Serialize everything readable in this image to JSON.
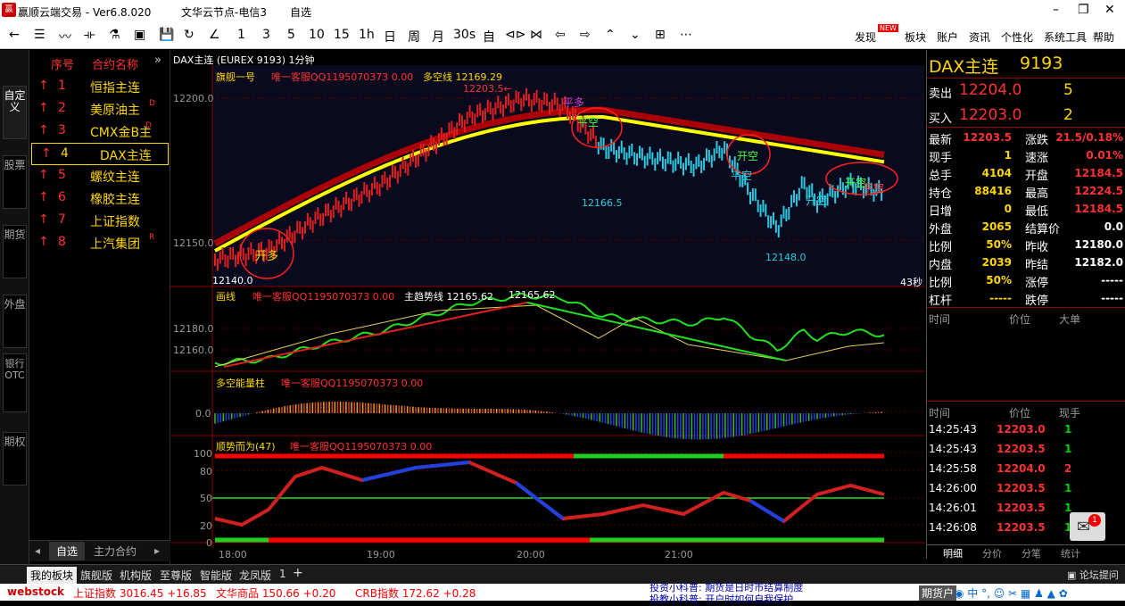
{
  "window": {
    "title": "赢顺云端交易 - Ver6.8.020",
    "node": "文华云节点-电信3",
    "mode": "自选",
    "win_buttons": [
      "–",
      "❐",
      "✕"
    ]
  },
  "toolbar": {
    "icons": [
      "←",
      "☰",
      "〰",
      "⟛",
      "⚗",
      "▣",
      "💾",
      "↻",
      "∠",
      "1",
      "3",
      "5",
      "10",
      "15",
      "1h",
      "日",
      "周",
      "月",
      "30s",
      "自",
      "⊲⊳",
      "⋈",
      "⇦",
      "⇨",
      "⌃",
      "⌄",
      "⊞",
      "⋯"
    ],
    "menu": [
      "发现",
      "板块",
      "账户",
      "资讯",
      "个性化",
      "系统工具",
      "帮助"
    ],
    "new_badge": "NEW"
  },
  "left_tabs": [
    "自定义",
    "股票",
    "期货",
    "外盘",
    "银行OTC",
    "期权"
  ],
  "watchlist": {
    "headers": [
      "序号",
      "合约名称"
    ],
    "more": "»",
    "rows": [
      {
        "n": "1",
        "name": "恒指主连",
        "sup": ""
      },
      {
        "n": "2",
        "name": "美原油主",
        "sup": "D"
      },
      {
        "n": "3",
        "name": "CMX金B主",
        "sup": "D"
      },
      {
        "n": "4",
        "name": "DAX主连",
        "sup": ""
      },
      {
        "n": "5",
        "name": "螺纹主连",
        "sup": ""
      },
      {
        "n": "6",
        "name": "橡胶主连",
        "sup": ""
      },
      {
        "n": "7",
        "name": "上证指数",
        "sup": ""
      },
      {
        "n": "8",
        "name": "上汽集团",
        "sup": "R"
      }
    ],
    "footer": [
      "自选",
      "主力合约"
    ]
  },
  "chart": {
    "header": "DAX主连 (EUREX 9193)  1分钟",
    "p1": {
      "name": "旗舰一号",
      "qq": "唯一客服QQ1195070373 0.00",
      "line_label": "多空线 12169.29",
      "y_ticks": [
        "12200.0",
        "12150.0"
      ],
      "annotations": [
        "12203.5←",
        "12166.5",
        "12148.0",
        "平多",
        "平空",
        "开空",
        "平空",
        "开空",
        "开空",
        "开多",
        "平空"
      ],
      "low": "12140.0",
      "countdown": "43秒"
    },
    "p2": {
      "name": "画线",
      "qq": "唯一客服QQ1195070373 0.00",
      "trend": "主趋势线 12165.62",
      "value": "12165.62",
      "y_ticks": [
        "12180.0",
        "12160.0"
      ]
    },
    "p3": {
      "name": "多空能量柱",
      "qq": "唯一客服QQ1195070373 0.00",
      "y_ticks": [
        "0.0"
      ]
    },
    "p4": {
      "name": "顺势而为(47)",
      "qq": "唯一客服QQ1195070373 0.00",
      "y_ticks": [
        "100",
        "80",
        "50",
        "20",
        "0"
      ]
    },
    "x_ticks": [
      "18:00",
      "19:00",
      "20:00",
      "21:00"
    ]
  },
  "quote": {
    "title": "DAX主连",
    "code": "9193",
    "sell": {
      "label": "卖出",
      "price": "12204.0",
      "vol": "5"
    },
    "buy": {
      "label": "买入",
      "price": "12203.0",
      "vol": "2"
    },
    "rows": [
      [
        "最新",
        "12203.5",
        "涨跌",
        "21.5/0.18%"
      ],
      [
        "现手",
        "1",
        "速涨",
        "0.01%"
      ],
      [
        "总手",
        "4104",
        "开盘",
        "12184.5"
      ],
      [
        "持仓",
        "88416",
        "最高",
        "12224.5"
      ],
      [
        "日增",
        "0",
        "最低",
        "12184.5"
      ],
      [
        "外盘",
        "2065",
        "结算价",
        "0.0"
      ],
      [
        "比例",
        "50%",
        "昨收",
        "12180.0"
      ],
      [
        "内盘",
        "2039",
        "昨结",
        "12182.0"
      ],
      [
        "比例",
        "50%",
        "涨停",
        "-----"
      ],
      [
        "杠杆",
        "-----",
        "跌停",
        "-----"
      ]
    ],
    "big_headers": [
      "时间",
      "价位",
      "大单"
    ],
    "tick_headers": [
      "时间",
      "价位",
      "现手"
    ],
    "ticks": [
      [
        "14:25:43",
        "12203.0",
        "1"
      ],
      [
        "14:25:43",
        "12203.5",
        "1"
      ],
      [
        "14:25:58",
        "12204.0",
        "2"
      ],
      [
        "14:26:00",
        "12203.5",
        "1"
      ],
      [
        "14:26:01",
        "12203.5",
        "1"
      ],
      [
        "14:26:08",
        "12203.5",
        "1"
      ]
    ],
    "tabs": [
      "明细",
      "分价",
      "分笔",
      "统计"
    ],
    "mail_badge": "1"
  },
  "bottom_tabs": [
    "我的板块",
    "旗舰版",
    "机构版",
    "至尊版",
    "智能版",
    "龙凤版",
    "1",
    "+"
  ],
  "forum": "论坛提问",
  "status": {
    "logo": "webstock",
    "items": [
      "上证指数 3016.45 +16.85",
      "文华商品 150.66 +0.20",
      "CRB指数 172.62 +0.28"
    ],
    "notice1": "投资小科普: 期货是日时市结算制度",
    "notice2": "投教小科普: 开户时如何自我保护",
    "account": "期货户"
  }
}
